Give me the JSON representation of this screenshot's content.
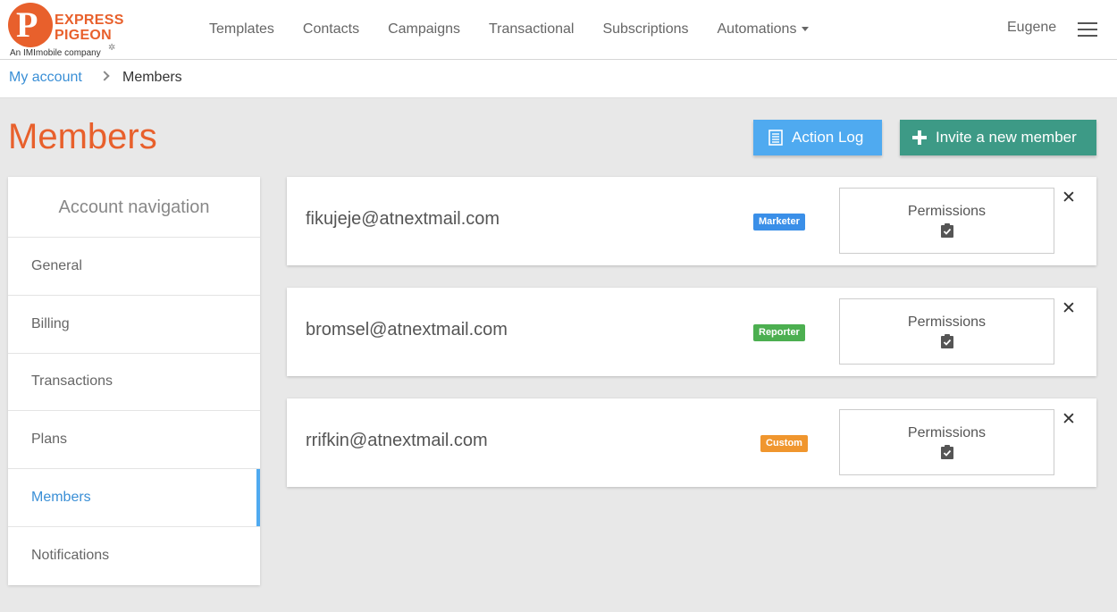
{
  "brand": {
    "line1": "EXPRESS",
    "line2": "PIGEON",
    "tagline": "An IMImobile company",
    "color": "#e8602c"
  },
  "nav": {
    "items": [
      {
        "label": "Templates"
      },
      {
        "label": "Contacts"
      },
      {
        "label": "Campaigns"
      },
      {
        "label": "Transactional"
      },
      {
        "label": "Subscriptions"
      },
      {
        "label": "Automations"
      }
    ],
    "user": "Eugene",
    "menu_icon": "hamburger-icon"
  },
  "breadcrumb": {
    "parent": "My account",
    "current": "Members"
  },
  "page": {
    "title": "Members"
  },
  "actions": {
    "action_log": "Action Log",
    "invite": "Invite a new member"
  },
  "sidebar": {
    "heading": "Account navigation",
    "items": [
      {
        "label": "General",
        "active": false
      },
      {
        "label": "Billing",
        "active": false
      },
      {
        "label": "Transactions",
        "active": false
      },
      {
        "label": "Plans",
        "active": false
      },
      {
        "label": "Members",
        "active": true
      },
      {
        "label": "Notifications",
        "active": false
      }
    ]
  },
  "members": [
    {
      "email": "fikujeje@atnextmail.com",
      "role": "Marketer",
      "role_color": "#3a8fe8",
      "permissions": "Permissions"
    },
    {
      "email": "bromsel@atnextmail.com",
      "role": "Reporter",
      "role_color": "#4caf50",
      "permissions": "Permissions"
    },
    {
      "email": "rrifkin@atnextmail.com",
      "role": "Custom",
      "role_color": "#f0962e",
      "permissions": "Permissions"
    }
  ],
  "colors": {
    "accent_blue": "#4faaf0",
    "invite_green": "#3d9a86",
    "title_orange": "#e8602c"
  }
}
